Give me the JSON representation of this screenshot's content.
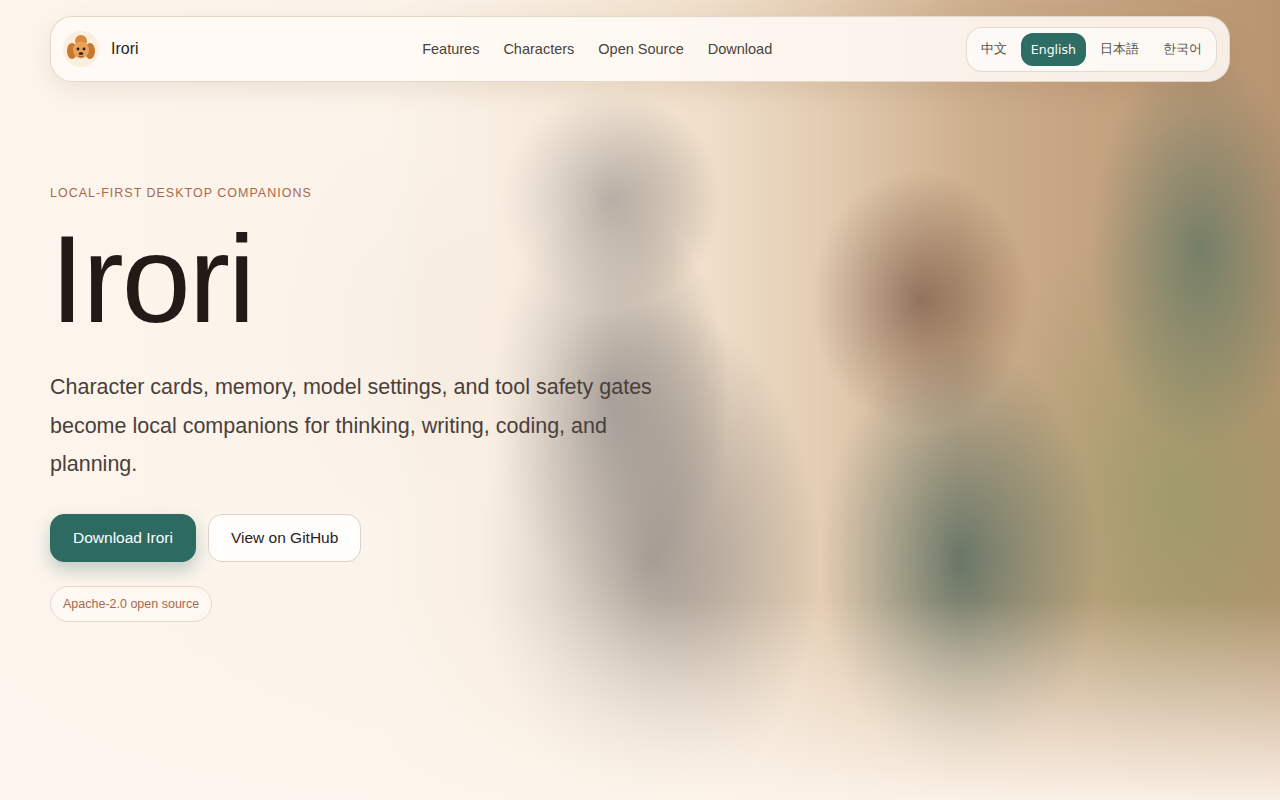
{
  "nav": {
    "logo_text": "Irori",
    "links": [
      "Features",
      "Characters",
      "Open Source",
      "Download"
    ],
    "languages": [
      {
        "label": "中文",
        "selected": false
      },
      {
        "label": "English",
        "selected": true
      },
      {
        "label": "日本語",
        "selected": false
      },
      {
        "label": "한국어",
        "selected": false
      }
    ]
  },
  "hero": {
    "eyebrow": "LOCAL-FIRST DESKTOP COMPANIONS",
    "title": "Irori",
    "description": "Character cards, memory, model settings, and tool safety gates become local companions for thinking, writing, coding, and planning.",
    "buttons": [
      {
        "label": "Download Irori",
        "kind": "primary"
      },
      {
        "label": "View on GitHub",
        "kind": "secondary"
      }
    ],
    "badge": "Apache-2.0 open source"
  }
}
